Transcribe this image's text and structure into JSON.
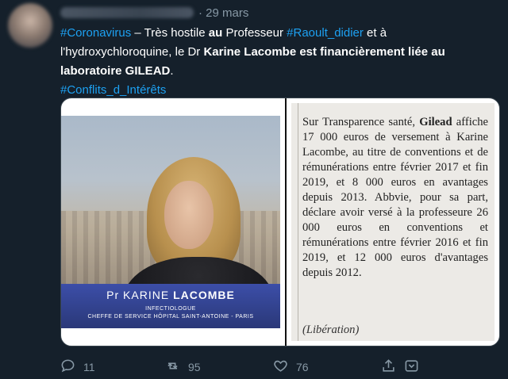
{
  "tweet": {
    "date": "· 29 mars",
    "text": {
      "hashtag_coronavirus": "#Coronavirus",
      "seg1": " – Très hostile ",
      "seg1_bold": "au",
      "seg2": " Professeur ",
      "hashtag_raoult": "#Raoult_didier",
      "seg3": " et à l'hydroxychloroquine, le Dr ",
      "bold_statement": "Karine Lacombe est financièrement liée au laboratoire GILEAD",
      "seg4": ".",
      "hashtag_conflits": "#Conflits_d_Intérêts"
    },
    "colors": {
      "background": "#15202b",
      "link": "#1da1f2",
      "muted": "#8899a6"
    }
  },
  "media": {
    "broadcast": {
      "name_prefix": "Pr",
      "name_first": "KARINE",
      "name_last": "LACOMBE",
      "role_line1": "INFECTIOLOGUE",
      "role_line2": "CHEFFE DE SERVICE HÔPITAL SAINT-ANTOINE - PARIS"
    },
    "quote": {
      "p1": "Sur Transparence santé, ",
      "p1_bold": "Gilead",
      "p2": " affiche 17 000 euros de versement à Karine Lacombe, au titre de conventions et de rémunérations entre février 2017 et fin 2019, et 8 000 euros en avantages depuis 2013. Abbvie, pour sa part, déclare avoir versé à la professeure 26 000 euros en conventions et rémunérations entre février 2016 et fin 2019, et 12 000 euros d'avantages depuis 2012.",
      "source": "(Libération)"
    }
  },
  "actions": {
    "reply": {
      "icon": "reply-icon",
      "count": "11"
    },
    "retweet": {
      "icon": "retweet-icon",
      "count": "95"
    },
    "like": {
      "icon": "heart-icon",
      "count": "76"
    },
    "share": {
      "icon": "share-icon"
    }
  }
}
